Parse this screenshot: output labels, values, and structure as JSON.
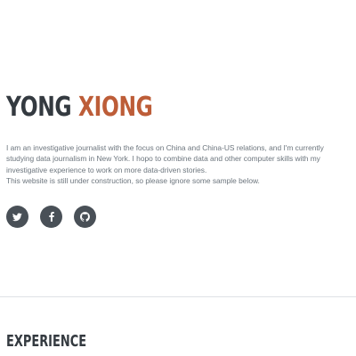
{
  "profile": {
    "first_name": "YONG",
    "last_name": "XIONG"
  },
  "bio": {
    "paragraph_1": "I am an investigative journalist with the focus on China and China-US relations, and I'm currently studying data journalism in New York. I hopo to combine data and other computer skills with my investigative experience to work on more data-driven stories.",
    "paragraph_2": "This website is still under construction, so please ignore some sample below."
  },
  "social": [
    {
      "icon": "twitter-icon"
    },
    {
      "icon": "facebook-icon"
    },
    {
      "icon": "github-icon"
    }
  ],
  "colors": {
    "primary": "#bd5d38",
    "heading": "#343a40",
    "text": "#6c757d",
    "social_bg": "#495057"
  },
  "sections": {
    "experience_title": "EXPERIENCE"
  }
}
